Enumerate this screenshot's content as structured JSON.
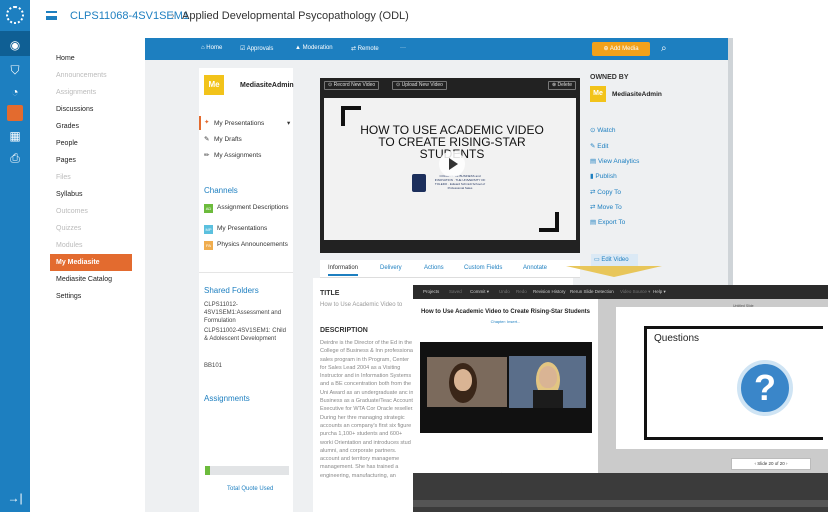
{
  "header": {
    "course_code": "CLPS11068-4SV1SEM1",
    "sep": "›",
    "title": "Applied Developmental Psycopathology (ODL)"
  },
  "course_nav": [
    {
      "label": "Home",
      "state": "normal"
    },
    {
      "label": "Announcements",
      "state": "disabled"
    },
    {
      "label": "Assignments",
      "state": "disabled"
    },
    {
      "label": "Discussions",
      "state": "normal"
    },
    {
      "label": "Grades",
      "state": "normal"
    },
    {
      "label": "People",
      "state": "normal"
    },
    {
      "label": "Pages",
      "state": "normal"
    },
    {
      "label": "Files",
      "state": "disabled"
    },
    {
      "label": "Syllabus",
      "state": "normal"
    },
    {
      "label": "Outcomes",
      "state": "disabled"
    },
    {
      "label": "Quizzes",
      "state": "disabled"
    },
    {
      "label": "Modules",
      "state": "disabled"
    },
    {
      "label": "My Mediasite",
      "state": "active"
    },
    {
      "label": "Mediasite Catalog",
      "state": "normal"
    },
    {
      "label": "Settings",
      "state": "normal"
    }
  ],
  "mediasite_bar": {
    "home": "Home",
    "approvals": "Approvals",
    "moderation": "Moderation",
    "remote": "Remote",
    "more": "···",
    "add_media": "Add Media"
  },
  "left_panel": {
    "avatar": "Me",
    "user": "MediasiteAdmin",
    "my_presentations": "My Presentations",
    "my_drafts": "My Drafts",
    "my_assignments": "My Assignments",
    "channels_heading": "Channels",
    "channels": [
      {
        "badge": "AD",
        "label": "Assignment Descriptions",
        "color": "#6cbb3c"
      },
      {
        "badge": "MP",
        "label": "My Presentations",
        "color": "#5bc0de"
      },
      {
        "badge": "PA",
        "label": "Physics Announcements",
        "color": "#f0ad4e"
      }
    ],
    "shared_heading": "Shared Folders",
    "shared": [
      "CLPS11012-4SV1SEM1:Assessment and Formulation",
      "CLPS11002-4SV1SEM1: Child & Adolescent Development",
      "BB101"
    ],
    "assignments_heading": "Assignments",
    "quota_label": "Total Quote Used",
    "quota_fraction": 0.06
  },
  "video": {
    "record_btn": "Record New Video",
    "upload_btn": "Upload New Video",
    "delete_btn": "Delete",
    "slide_title": "HOW TO USE ACADEMIC VIDEO TO CREATE RISING-STAR STUDENTS",
    "logo_text": "COLLEGE OF BUSINESS and INNOVATION · THE UNIVERSITY OF TOLEDO · Edward Schmidt School of Professional Sales"
  },
  "owned": {
    "heading": "OWNED BY",
    "avatar": "Me",
    "user": "MediasiteAdmin"
  },
  "actions": [
    "Watch",
    "Edit",
    "View Analytics",
    "Publish",
    "Copy To",
    "Move To",
    "Export To"
  ],
  "edit_video": "Edit Video",
  "tabs": [
    "Information",
    "Delivery",
    "Actions",
    "Custom Fields",
    "Annotate"
  ],
  "info": {
    "title_label": "TITLE",
    "title_value": "How to Use Academic Video to",
    "desc_label": "DESCRIPTION",
    "desc_value": "Deirdre is the Director of the Ed in the College of Business & Inn professional sales program in th Program, Center for Sales Lead 2004 as a Visiting Instructor and in Information Systems and a BE concentration both from the Uni Award as an undergraduate anc in Business as a Graduate/Teac Account Executive for WTA Cor Oracle reseller. During her thre managing strategic accounts an company's first six figure purcha 1,100+ students and 600+ worki Orientation and introduces stud alumni, and corporate partners. account and territory manageme management. She has trained a engineering, manufacturing, an"
  },
  "editor": {
    "menu": [
      "Projects",
      "Saved",
      "Commit ▾",
      "Undo",
      "Redo",
      "Revision History",
      "Rerun Slide Detection",
      "Video Source ▾",
      "Help ▾"
    ],
    "title": "How to Use Academic Video to Create Rising-Star Students",
    "chapter": "Chapter: Insert...",
    "unlisted": "Untitled Slide",
    "slide_text": "Questions",
    "slide_nav": "‹     Slide 20 of 20     ›"
  }
}
